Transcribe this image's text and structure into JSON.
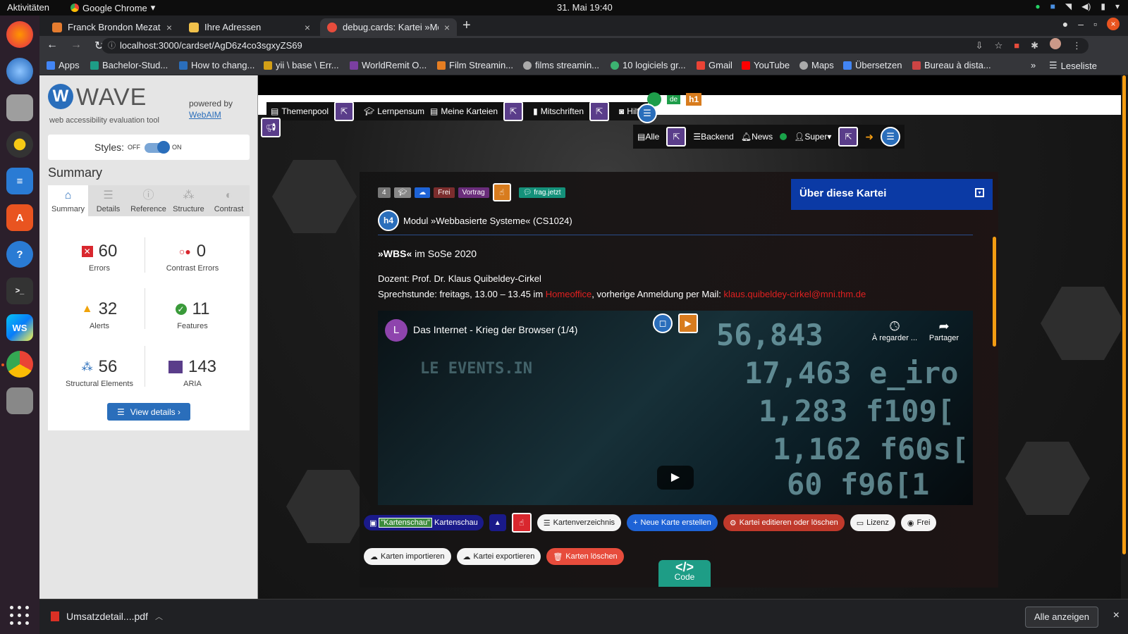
{
  "os": {
    "activities": "Aktivitäten",
    "app_name": "Google Chrome",
    "clock": "31. Mai  19:40"
  },
  "browser": {
    "tabs": [
      {
        "title": "Franck Brondon Mezatio",
        "favicon_color": "#e57c2f",
        "active": false
      },
      {
        "title": "Ihre Adressen",
        "favicon_color": "#f0c14b",
        "active": false
      },
      {
        "title": "debug.cards: Kartei »Mod",
        "favicon_color": "#e74c3c",
        "active": true
      }
    ],
    "url": "localhost:3000/cardset/AgD6z4co3sgxyZS69",
    "bookmarks": [
      {
        "label": "Apps",
        "color": "#4285f4"
      },
      {
        "label": "Bachelor-Stud...",
        "color": "#1e9d86"
      },
      {
        "label": "How to chang...",
        "color": "#2a6ebb"
      },
      {
        "label": "yii \\ base \\ Err...",
        "color": "#d4a017"
      },
      {
        "label": "WorldRemit O...",
        "color": "#7b3fa0"
      },
      {
        "label": "Film Streamin...",
        "color": "#e67e22"
      },
      {
        "label": "films streamin...",
        "color": "#aaaaaa"
      },
      {
        "label": "10 logiciels gr...",
        "color": "#3cb371"
      },
      {
        "label": "Gmail",
        "color": "#ea4335"
      },
      {
        "label": "YouTube",
        "color": "#ff0000"
      },
      {
        "label": "Maps",
        "color": "#aaaaaa"
      },
      {
        "label": "Übersetzen",
        "color": "#4285f4"
      },
      {
        "label": "Bureau à dista...",
        "color": "#cc4444"
      }
    ],
    "reading_list": "Leseliste"
  },
  "wave": {
    "name": "WAVE",
    "subtitle": "web accessibility evaluation tool",
    "powered_by": "powered by",
    "webaim": "WebAIM",
    "styles_label": "Styles:",
    "styles_off": "OFF",
    "styles_on": "ON",
    "summary_heading": "Summary",
    "tabs": [
      "Summary",
      "Details",
      "Reference",
      "Structure",
      "Contrast"
    ],
    "stats": {
      "errors": {
        "value": "60",
        "label": "Errors"
      },
      "contrast": {
        "value": "0",
        "label": "Contrast Errors"
      },
      "alerts": {
        "value": "32",
        "label": "Alerts"
      },
      "features": {
        "value": "11",
        "label": "Features"
      },
      "structural": {
        "value": "56",
        "label": "Structural Elements"
      },
      "aria": {
        "value": "143",
        "label": "ARIA"
      }
    },
    "view_details": "View details ›"
  },
  "site": {
    "nav": [
      "Themenpool",
      "Lernpensum",
      "Meine Karteien",
      "Mitschriften",
      "Hilfe"
    ],
    "lang_badge": "de",
    "h1_badge": "h1",
    "subnav": [
      "Alle",
      "Backend",
      "News",
      "Super"
    ],
    "badges": [
      {
        "label": "4",
        "color": "#777777"
      },
      {
        "label": "",
        "color": "#888888"
      },
      {
        "label": "",
        "color": "#1e63d6"
      },
      {
        "label": "Frei",
        "color": "#7b2d2d"
      },
      {
        "label": "Vortrag",
        "color": "#6a2d7b"
      },
      {
        "label": "frag.jetzt",
        "color": "#14917a"
      }
    ],
    "about": "Über diese Kartei",
    "h4": "h4",
    "module_title": "Modul »Webbasierte Systeme« (CS1024)",
    "semester_bold": "»WBS«",
    "semester_rest": " im SoSe 2020",
    "dozent": "Dozent: Prof. Dr. Klaus Quibeldey-Cirkel",
    "sprech_pre": "Sprechstunde: freitags, 13.00 – 13.45 im ",
    "sprech_link": "Homeoffice",
    "sprech_mid": ", vorherige Anmeldung per Mail: ",
    "sprech_mail": "klaus.quibeldey-cirkel@mni.thm.de",
    "video": {
      "avatar": "L",
      "title": "Das Internet - Krieg der Browser (1/4)",
      "watch_later": "À regarder ...",
      "share": "Partager"
    },
    "kartenschau_selected": "\"Kartenschau\"",
    "kartenschau": "Kartenschau",
    "buttons_row1": [
      "Kartenverzeichnis",
      "Neue Karte erstellen",
      "Kartei editieren oder löschen",
      "Lizenz",
      "Frei"
    ],
    "buttons_row2": [
      "Karten importieren",
      "Kartei exportieren",
      "Karten löschen"
    ],
    "code": "Code"
  },
  "downloads": {
    "file": "Umsatzdetail....pdf",
    "show_all": "Alle anzeigen"
  }
}
